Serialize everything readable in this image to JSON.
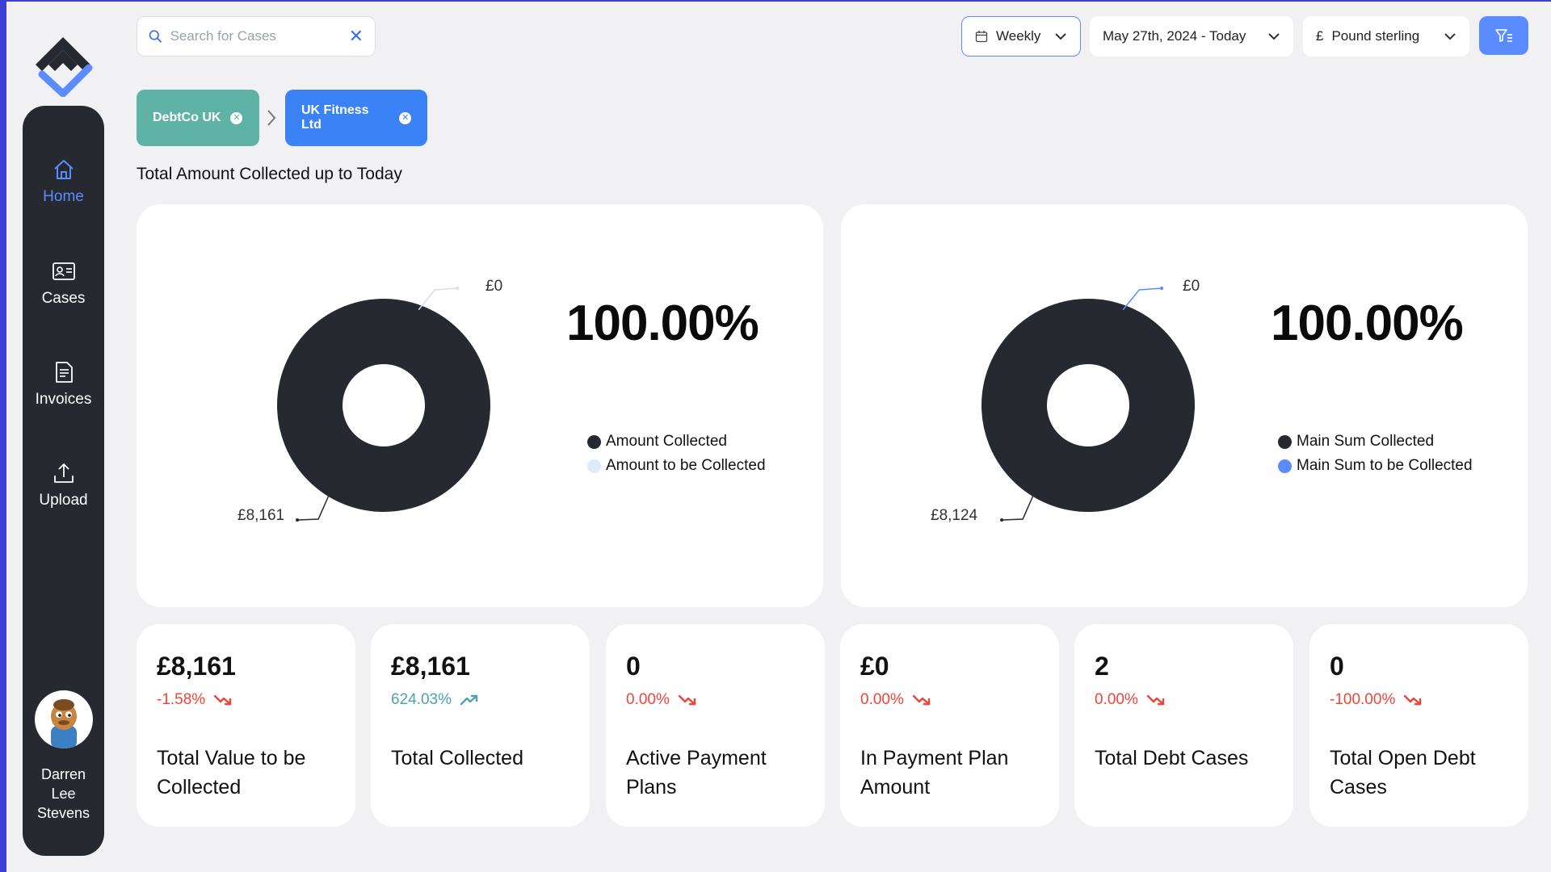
{
  "search": {
    "placeholder": "Search for Cases"
  },
  "header": {
    "period": "Weekly",
    "date_range": "May 27th, 2024 - Today",
    "currency_symbol": "£",
    "currency": "Pound sterling"
  },
  "breadcrumb": [
    {
      "label": "DebtCo UK",
      "color": "#5fb3a6"
    },
    {
      "label": "UK Fitness Ltd",
      "color": "#3b82f6"
    }
  ],
  "sidebar": {
    "items": [
      {
        "label": "Home",
        "icon": "home-icon",
        "active": true
      },
      {
        "label": "Cases",
        "icon": "id-card-icon",
        "active": false
      },
      {
        "label": "Invoices",
        "icon": "invoice-icon",
        "active": false
      },
      {
        "label": "Upload",
        "icon": "upload-icon",
        "active": false
      }
    ],
    "user": {
      "name_lines": [
        "Darren",
        "Lee",
        "Stevens"
      ]
    }
  },
  "section_title": "Total Amount Collected up to Today",
  "charts": [
    {
      "percent": "100.00%",
      "label_collected": "£8,161",
      "label_remaining": "£0",
      "legend": [
        {
          "label": "Amount Collected",
          "color": "#262a30"
        },
        {
          "label": "Amount to be Collected",
          "color": "#e4e8fb"
        }
      ]
    },
    {
      "percent": "100.00%",
      "label_collected": "£8,124",
      "label_remaining": "£0",
      "legend": [
        {
          "label": "Main Sum Collected",
          "color": "#262a30"
        },
        {
          "label": "Main Sum to be Collected",
          "color": "#5b8cff"
        }
      ]
    }
  ],
  "chart_data": [
    {
      "type": "pie",
      "categories": [
        "Amount Collected",
        "Amount to be Collected"
      ],
      "values": [
        8161,
        0
      ],
      "value_labels": [
        "£8,161",
        "£0"
      ],
      "percent_label": "100.00%"
    },
    {
      "type": "pie",
      "categories": [
        "Main Sum Collected",
        "Main Sum to be Collected"
      ],
      "values": [
        8124,
        0
      ],
      "value_labels": [
        "£8,124",
        "£0"
      ],
      "percent_label": "100.00%"
    }
  ],
  "kpis": [
    {
      "value": "£8,161",
      "change": "-1.58%",
      "trend": "down",
      "label": "Total Value to be Collected"
    },
    {
      "value": "£8,161",
      "change": "624.03%",
      "trend": "up",
      "label": "Total Collected"
    },
    {
      "value": "0",
      "change": "0.00%",
      "trend": "down",
      "label": "Active Payment Plans"
    },
    {
      "value": "£0",
      "change": "0.00%",
      "trend": "down",
      "label": "In Payment Plan Amount"
    },
    {
      "value": "2",
      "change": "0.00%",
      "trend": "down",
      "label": "Total Debt Cases"
    },
    {
      "value": "0",
      "change": "-100.00%",
      "trend": "down",
      "label": "Total Open Debt Cases"
    }
  ],
  "colors": {
    "down": "#f04438",
    "up": "#4ba3b0",
    "accent": "#5b8cff",
    "sidebar_bg": "#262a30",
    "chart_dark": "#262a30"
  }
}
